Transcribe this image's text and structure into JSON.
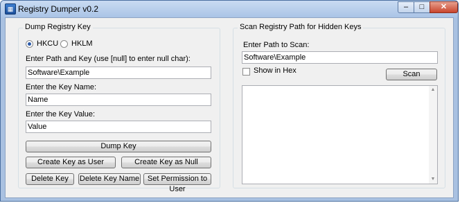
{
  "window": {
    "title": "Registry Dumper v0.2",
    "icon": "registry-app-icon",
    "min_icon": "minimize-icon",
    "max_icon": "maximize-icon",
    "close_icon": "close-icon"
  },
  "dump": {
    "group_title": "Dump Registry Key",
    "hive_options": [
      "HKCU",
      "HKLM"
    ],
    "selected_hive": "HKCU",
    "path_label": "Enter Path and Key (use [null] to enter null char):",
    "path_value": "Software\\Example",
    "name_label": "Enter the Key Name:",
    "name_value": "Name",
    "value_label": "Enter the Key Value:",
    "value_value": "Value",
    "dump_button": "Dump Key",
    "create_user_button": "Create Key as User",
    "create_null_button": "Create Key as Null",
    "delete_key_button": "Delete Key",
    "delete_name_button": "Delete Key Name",
    "set_perm_button": "Set Permission to User"
  },
  "scan": {
    "group_title": "Scan Registry Path for Hidden Keys",
    "path_label": "Enter Path to Scan:",
    "path_value": "Software\\Example",
    "hex_label": "Show in Hex",
    "hex_checked": false,
    "scan_button": "Scan",
    "output": ""
  }
}
